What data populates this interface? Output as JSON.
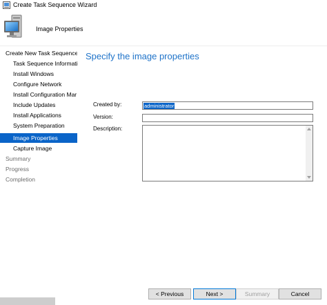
{
  "window": {
    "title": "Create Task Sequence Wizard"
  },
  "header": {
    "title": "Image Properties"
  },
  "nav": {
    "items": [
      {
        "label": "Create New Task Sequence",
        "state": "normal"
      },
      {
        "label": "Task Sequence Informatio",
        "state": "normal"
      },
      {
        "label": "Install Windows",
        "state": "normal"
      },
      {
        "label": "Configure Network",
        "state": "normal"
      },
      {
        "label": "Install Configuration Mar",
        "state": "normal"
      },
      {
        "label": "Include Updates",
        "state": "normal"
      },
      {
        "label": "Install Applications",
        "state": "normal"
      },
      {
        "label": "System Preparation",
        "state": "normal"
      },
      {
        "label": "Image Properties",
        "state": "selected"
      },
      {
        "label": "Capture Image",
        "state": "normal"
      },
      {
        "label": "Summary",
        "state": "disabled"
      },
      {
        "label": "Progress",
        "state": "disabled"
      },
      {
        "label": "Completion",
        "state": "disabled"
      }
    ]
  },
  "main": {
    "heading": "Specify the image properties",
    "created_by_label": "Created by:",
    "created_by_value": "administrator",
    "version_label": "Version:",
    "version_value": "",
    "description_label": "Description:",
    "description_value": ""
  },
  "buttons": {
    "previous": "< Previous",
    "next": "Next >",
    "summary": "Summary",
    "cancel": "Cancel"
  },
  "colors": {
    "accent": "#0a64c8",
    "heading": "#1f73c9"
  }
}
